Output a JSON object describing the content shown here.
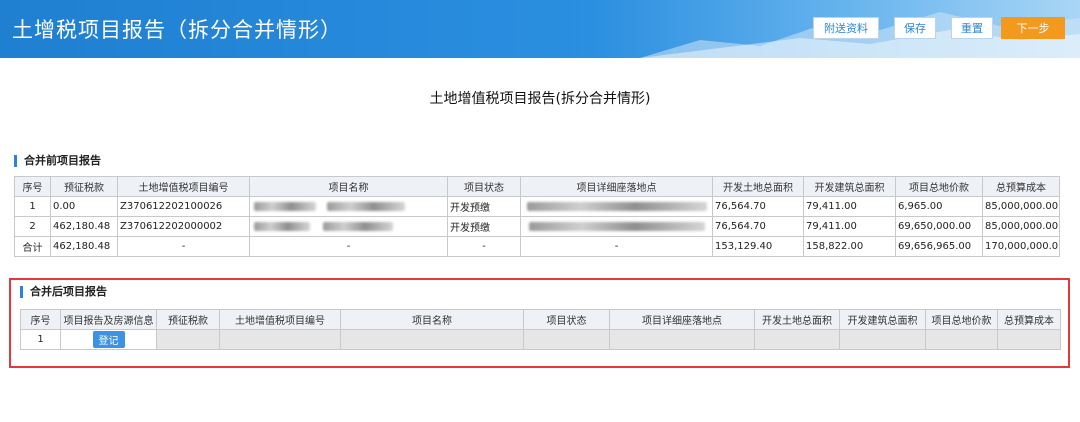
{
  "header": {
    "title": "土增税项目报告（拆分合并情形）",
    "buttons": {
      "attach": "附送资料",
      "save": "保存",
      "reset": "重置",
      "next": "下一步"
    }
  },
  "page_title": "土地增值税项目报告(拆分合并情形)",
  "before": {
    "label": "合并前项目报告",
    "columns": [
      "序号",
      "预征税款",
      "土地增值税项目编号",
      "项目名称",
      "项目状态",
      "项目详细座落地点",
      "开发土地总面积",
      "开发建筑总面积",
      "项目总地价款",
      "总预算成本"
    ],
    "rows": [
      {
        "no": "1",
        "tax": "0.00",
        "code": "Z370612202100026",
        "name": "",
        "status": "开发预缴",
        "addr": "",
        "land": "76,564.70",
        "build": "79,411.00",
        "price": "6,965.00",
        "budget": "85,000,000.00"
      },
      {
        "no": "2",
        "tax": "462,180.48",
        "code": "Z370612202000002",
        "name": "",
        "status": "开发预缴",
        "addr": "",
        "land": "76,564.70",
        "build": "79,411.00",
        "price": "69,650,000.00",
        "budget": "85,000,000.00"
      }
    ],
    "total": {
      "no": "合计",
      "tax": "462,180.48",
      "code": "-",
      "name": "-",
      "status": "-",
      "addr": "-",
      "land": "153,129.40",
      "build": "158,822.00",
      "price": "69,656,965.00",
      "budget": "170,000,000.0"
    }
  },
  "after": {
    "label": "合并后项目报告",
    "columns": [
      "序号",
      "项目报告及房源信息",
      "预征税款",
      "土地增值税项目编号",
      "项目名称",
      "项目状态",
      "项目详细座落地点",
      "开发土地总面积",
      "开发建筑总面积",
      "项目总地价款",
      "总预算成本"
    ],
    "row": {
      "no": "1",
      "register": "登记"
    }
  }
}
